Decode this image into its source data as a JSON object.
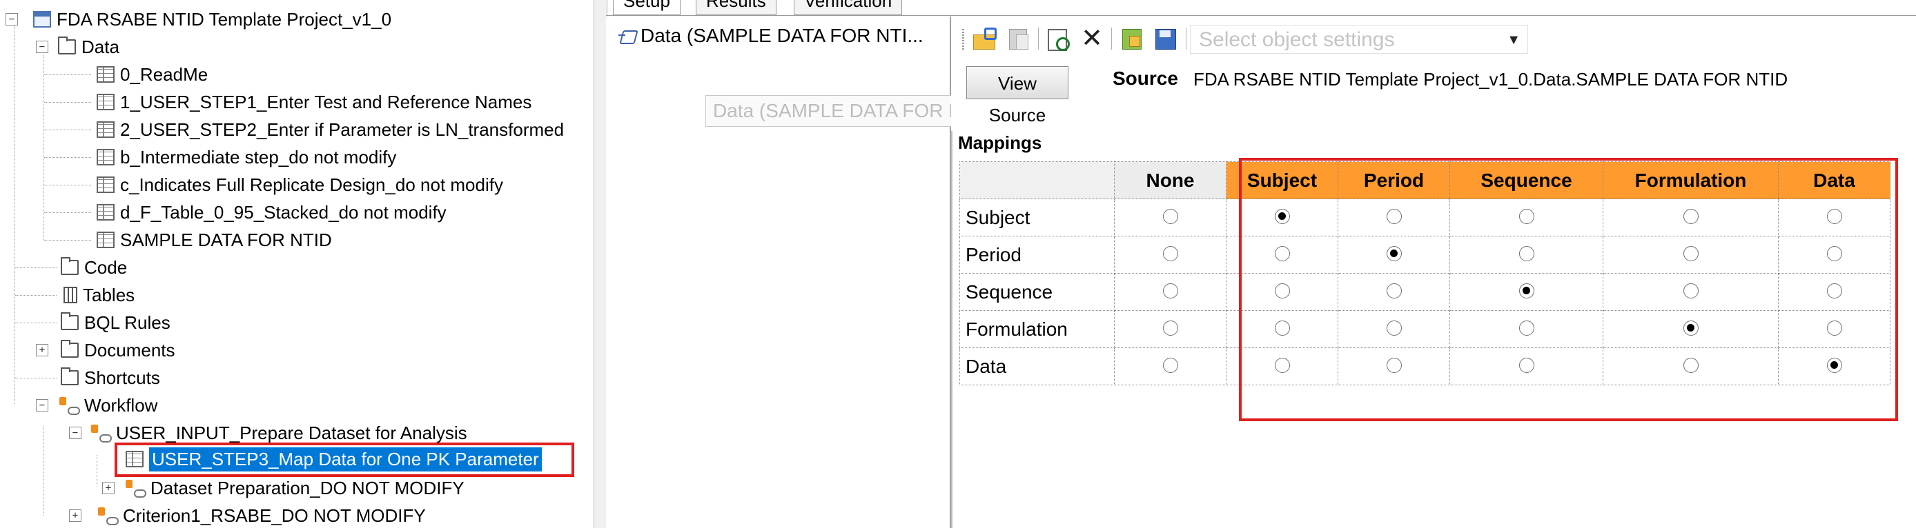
{
  "tree": {
    "items": [
      {
        "label": "FDA RSABE NTID Template Project_v1_0"
      },
      {
        "label": "Data"
      },
      {
        "label": "0_ReadMe"
      },
      {
        "label": "1_USER_STEP1_Enter Test and Reference Names"
      },
      {
        "label": "2_USER_STEP2_Enter if Parameter is LN_transformed"
      },
      {
        "label": "b_Intermediate step_do not modify"
      },
      {
        "label": "c_Indicates Full Replicate Design_do not modify"
      },
      {
        "label": "d_F_Table_0_95_Stacked_do not modify"
      },
      {
        "label": "SAMPLE DATA FOR NTID"
      },
      {
        "label": "Code"
      },
      {
        "label": "Tables"
      },
      {
        "label": "BQL Rules"
      },
      {
        "label": "Documents"
      },
      {
        "label": "Shortcuts"
      },
      {
        "label": "Workflow"
      },
      {
        "label": "USER_INPUT_Prepare Dataset for Analysis"
      },
      {
        "label": "USER_STEP3_Map Data for One PK Parameter"
      },
      {
        "label": "Dataset Preparation_DO NOT MODIFY"
      },
      {
        "label": "Criterion1_RSABE_DO NOT MODIFY"
      }
    ]
  },
  "tabs": {
    "setup": "Setup",
    "results": "Results",
    "verification": "Verification"
  },
  "objects": {
    "item": "Data (SAMPLE DATA FOR NTI...",
    "drag_ghost": "Data (SAMPLE DATA FOR NTID)"
  },
  "toolbar": {
    "settings_placeholder": "Select object settings"
  },
  "source": {
    "button": "View Source",
    "label": "Source",
    "value": "FDA RSABE NTID Template Project_v1_0.Data.SAMPLE DATA FOR NTID"
  },
  "mappings": {
    "label": "Mappings",
    "columns": [
      "None",
      "Subject",
      "Period",
      "Sequence",
      "Formulation",
      "Data"
    ],
    "rows": [
      {
        "name": "Subject",
        "selected": "Subject"
      },
      {
        "name": "Period",
        "selected": "Period"
      },
      {
        "name": "Sequence",
        "selected": "Sequence"
      },
      {
        "name": "Formulation",
        "selected": "Formulation"
      },
      {
        "name": "Data",
        "selected": "Data"
      }
    ]
  },
  "colors": {
    "selection": "#0078d7",
    "highlight": "#e02020",
    "mapped_header": "#ff9a2e"
  }
}
